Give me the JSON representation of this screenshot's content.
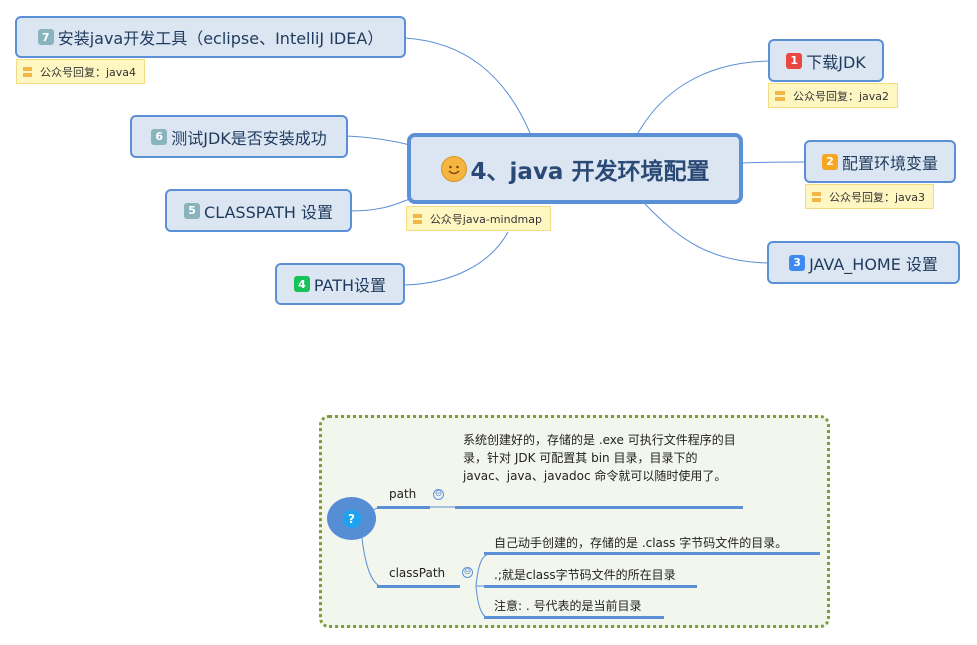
{
  "central": {
    "icon": "smiley-icon",
    "title": "4、java 开发环境配置",
    "note": "公众号java-mindmap"
  },
  "topics": [
    {
      "number": "1",
      "label": "下载JDK",
      "badge_color": "#e8483f",
      "note": "公众号回复：java2"
    },
    {
      "number": "2",
      "label": "配置环境变量",
      "badge_color": "#f5a623",
      "note": "公众号回复：java3"
    },
    {
      "number": "3",
      "label": "JAVA_HOME 设置",
      "badge_color": "#3d8bf0",
      "note": null
    },
    {
      "number": "4",
      "label": "PATH设置",
      "badge_color": "#18c25a",
      "note": null
    },
    {
      "number": "5",
      "label": "CLASSPATH 设置",
      "badge_color": "#8ab4bd",
      "note": null
    },
    {
      "number": "6",
      "label": "测试JDK是否安装成功",
      "badge_color": "#8ab4bd",
      "note": null
    },
    {
      "number": "7",
      "label": "安装java开发工具（eclipse、IntelliJ IDEA）",
      "badge_color": "#8ab4bd",
      "note": "公众号回复：java4"
    }
  ],
  "floating": {
    "root_icon": "question-icon",
    "root_symbol": "?",
    "collapse_symbol": "⊖",
    "branches": [
      {
        "label": "path",
        "children": [
          "系统创建好的，存储的是 .exe 可执行文件程序的目录，针对 JDK 可配置其 bin 目录，目录下的 javac、java、javadoc 命令就可以随时使用了。"
        ]
      },
      {
        "label": "classPath",
        "children": [
          "自己动手创建的，存储的是 .class 字节码文件的目录。",
          ".;就是class字节码文件的所在目录",
          "注意: . 号代表的是当前目录"
        ]
      }
    ]
  },
  "colors": {
    "topic_fill": "#dce6f3",
    "topic_border": "#5b8fd6",
    "note_fill": "#fff7c2",
    "boundary_border": "#7f9a3e",
    "boundary_fill": "#f2f6ec"
  }
}
